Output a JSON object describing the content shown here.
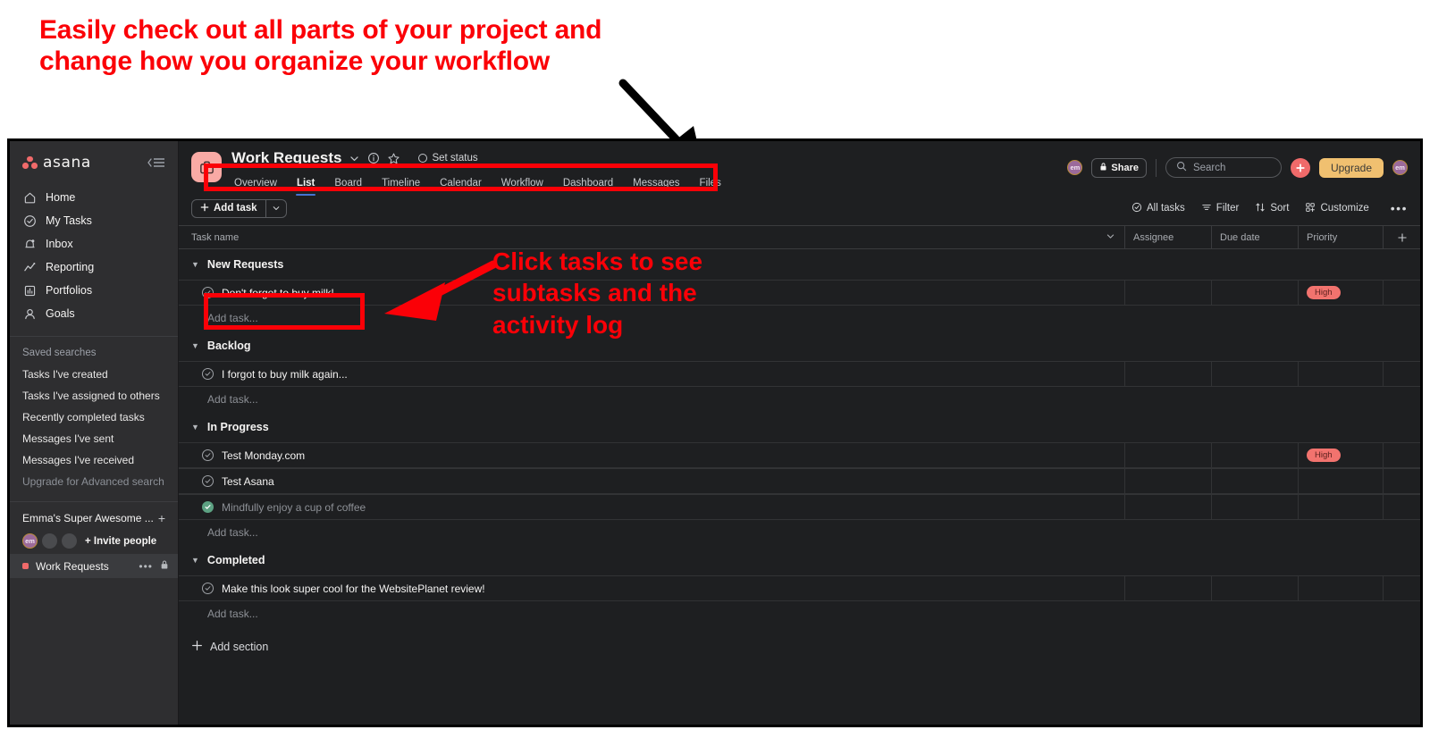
{
  "annotations": {
    "top_callout": "Easily check out all parts of your project and\nchange how you organize your workflow",
    "mid_callout": "Click tasks to see\nsubtasks and the\nactivity log",
    "callout_color": "#fb0007",
    "arrow_top_color": "#000000",
    "arrow_mid_color": "#fb0007"
  },
  "sidebar": {
    "logo_text": "asana",
    "collapse_icon": "collapse-sidebar-icon",
    "nav": [
      {
        "label": "Home",
        "icon": "home-icon"
      },
      {
        "label": "My Tasks",
        "icon": "check-circle-icon"
      },
      {
        "label": "Inbox",
        "icon": "bell-icon"
      },
      {
        "label": "Reporting",
        "icon": "chart-line-icon"
      },
      {
        "label": "Portfolios",
        "icon": "portfolio-icon"
      },
      {
        "label": "Goals",
        "icon": "goal-icon"
      }
    ],
    "saved_searches_title": "Saved searches",
    "saved_searches": [
      {
        "label": "Tasks I've created",
        "dim": false
      },
      {
        "label": "Tasks I've assigned to others",
        "dim": false
      },
      {
        "label": "Recently completed tasks",
        "dim": false
      },
      {
        "label": "Messages I've sent",
        "dim": false
      },
      {
        "label": "Messages I've received",
        "dim": false
      },
      {
        "label": "Upgrade for Advanced search",
        "dim": true
      }
    ],
    "team_name": "Emma's Super Awesome ...",
    "team_add_icon": "plus-icon",
    "avatar_initials": "em",
    "invite_label": "+ Invite people",
    "project": {
      "name": "Work Requests",
      "dot_color": "#f06a6a",
      "more_icon": "ellipsis-icon",
      "lock_icon": "lock-icon"
    }
  },
  "header": {
    "project_icon": "briefcase-icon",
    "project_title": "Work Requests",
    "caret_icon": "chevron-down-icon",
    "info_icon": "info-circle-icon",
    "star_icon": "star-icon",
    "set_status_label": "Set status",
    "tabs": [
      {
        "label": "Overview",
        "active": false
      },
      {
        "label": "List",
        "active": true
      },
      {
        "label": "Board",
        "active": false
      },
      {
        "label": "Timeline",
        "active": false
      },
      {
        "label": "Calendar",
        "active": false
      },
      {
        "label": "Workflow",
        "active": false
      },
      {
        "label": "Dashboard",
        "active": false
      },
      {
        "label": "Messages",
        "active": false
      },
      {
        "label": "Files",
        "active": false
      }
    ],
    "avatar_initials": "em",
    "share_label": "Share",
    "share_icon": "lock-icon",
    "search_placeholder": "Search",
    "search_value": "",
    "search_icon": "search-icon",
    "create_icon": "plus-icon",
    "upgrade_label": "Upgrade",
    "profile_initials": "em",
    "accent_coral": "#f06a6a",
    "accent_upgrade": "#f0c070"
  },
  "toolbar": {
    "add_task_label": "Add task",
    "add_task_caret_icon": "chevron-down-icon",
    "right_buttons": [
      {
        "label": "All tasks",
        "icon": "check-circle-icon"
      },
      {
        "label": "Filter",
        "icon": "filter-icon"
      },
      {
        "label": "Sort",
        "icon": "sort-icon"
      },
      {
        "label": "Customize",
        "icon": "customize-icon"
      }
    ],
    "more_icon": "ellipsis-icon"
  },
  "table": {
    "columns": {
      "name": "Task name",
      "assignee": "Assignee",
      "due_date": "Due date",
      "priority": "Priority",
      "add_column_icon": "plus-icon",
      "name_caret_icon": "chevron-down-icon"
    },
    "add_task_row_label": "Add task...",
    "add_section_label": "Add section",
    "add_section_icon": "plus-icon",
    "sections": [
      {
        "title": "New Requests",
        "tasks": [
          {
            "name": "Don't forget to buy milk!",
            "completed": false,
            "assignee": "",
            "due_date": "",
            "priority": "High"
          }
        ]
      },
      {
        "title": "Backlog",
        "tasks": [
          {
            "name": "I forgot to buy milk again...",
            "completed": false,
            "assignee": "",
            "due_date": "",
            "priority": ""
          }
        ]
      },
      {
        "title": "In Progress",
        "tasks": [
          {
            "name": "Test Monday.com",
            "completed": false,
            "assignee": "",
            "due_date": "",
            "priority": "High"
          },
          {
            "name": "Test Asana",
            "completed": false,
            "assignee": "",
            "due_date": "",
            "priority": ""
          },
          {
            "name": "Mindfully enjoy a cup of coffee",
            "completed": true,
            "assignee": "",
            "due_date": "",
            "priority": ""
          }
        ]
      },
      {
        "title": "Completed",
        "tasks": [
          {
            "name": "Make this look super cool for the WebsitePlanet review!",
            "completed": false,
            "assignee": "",
            "due_date": "",
            "priority": ""
          }
        ]
      }
    ]
  }
}
